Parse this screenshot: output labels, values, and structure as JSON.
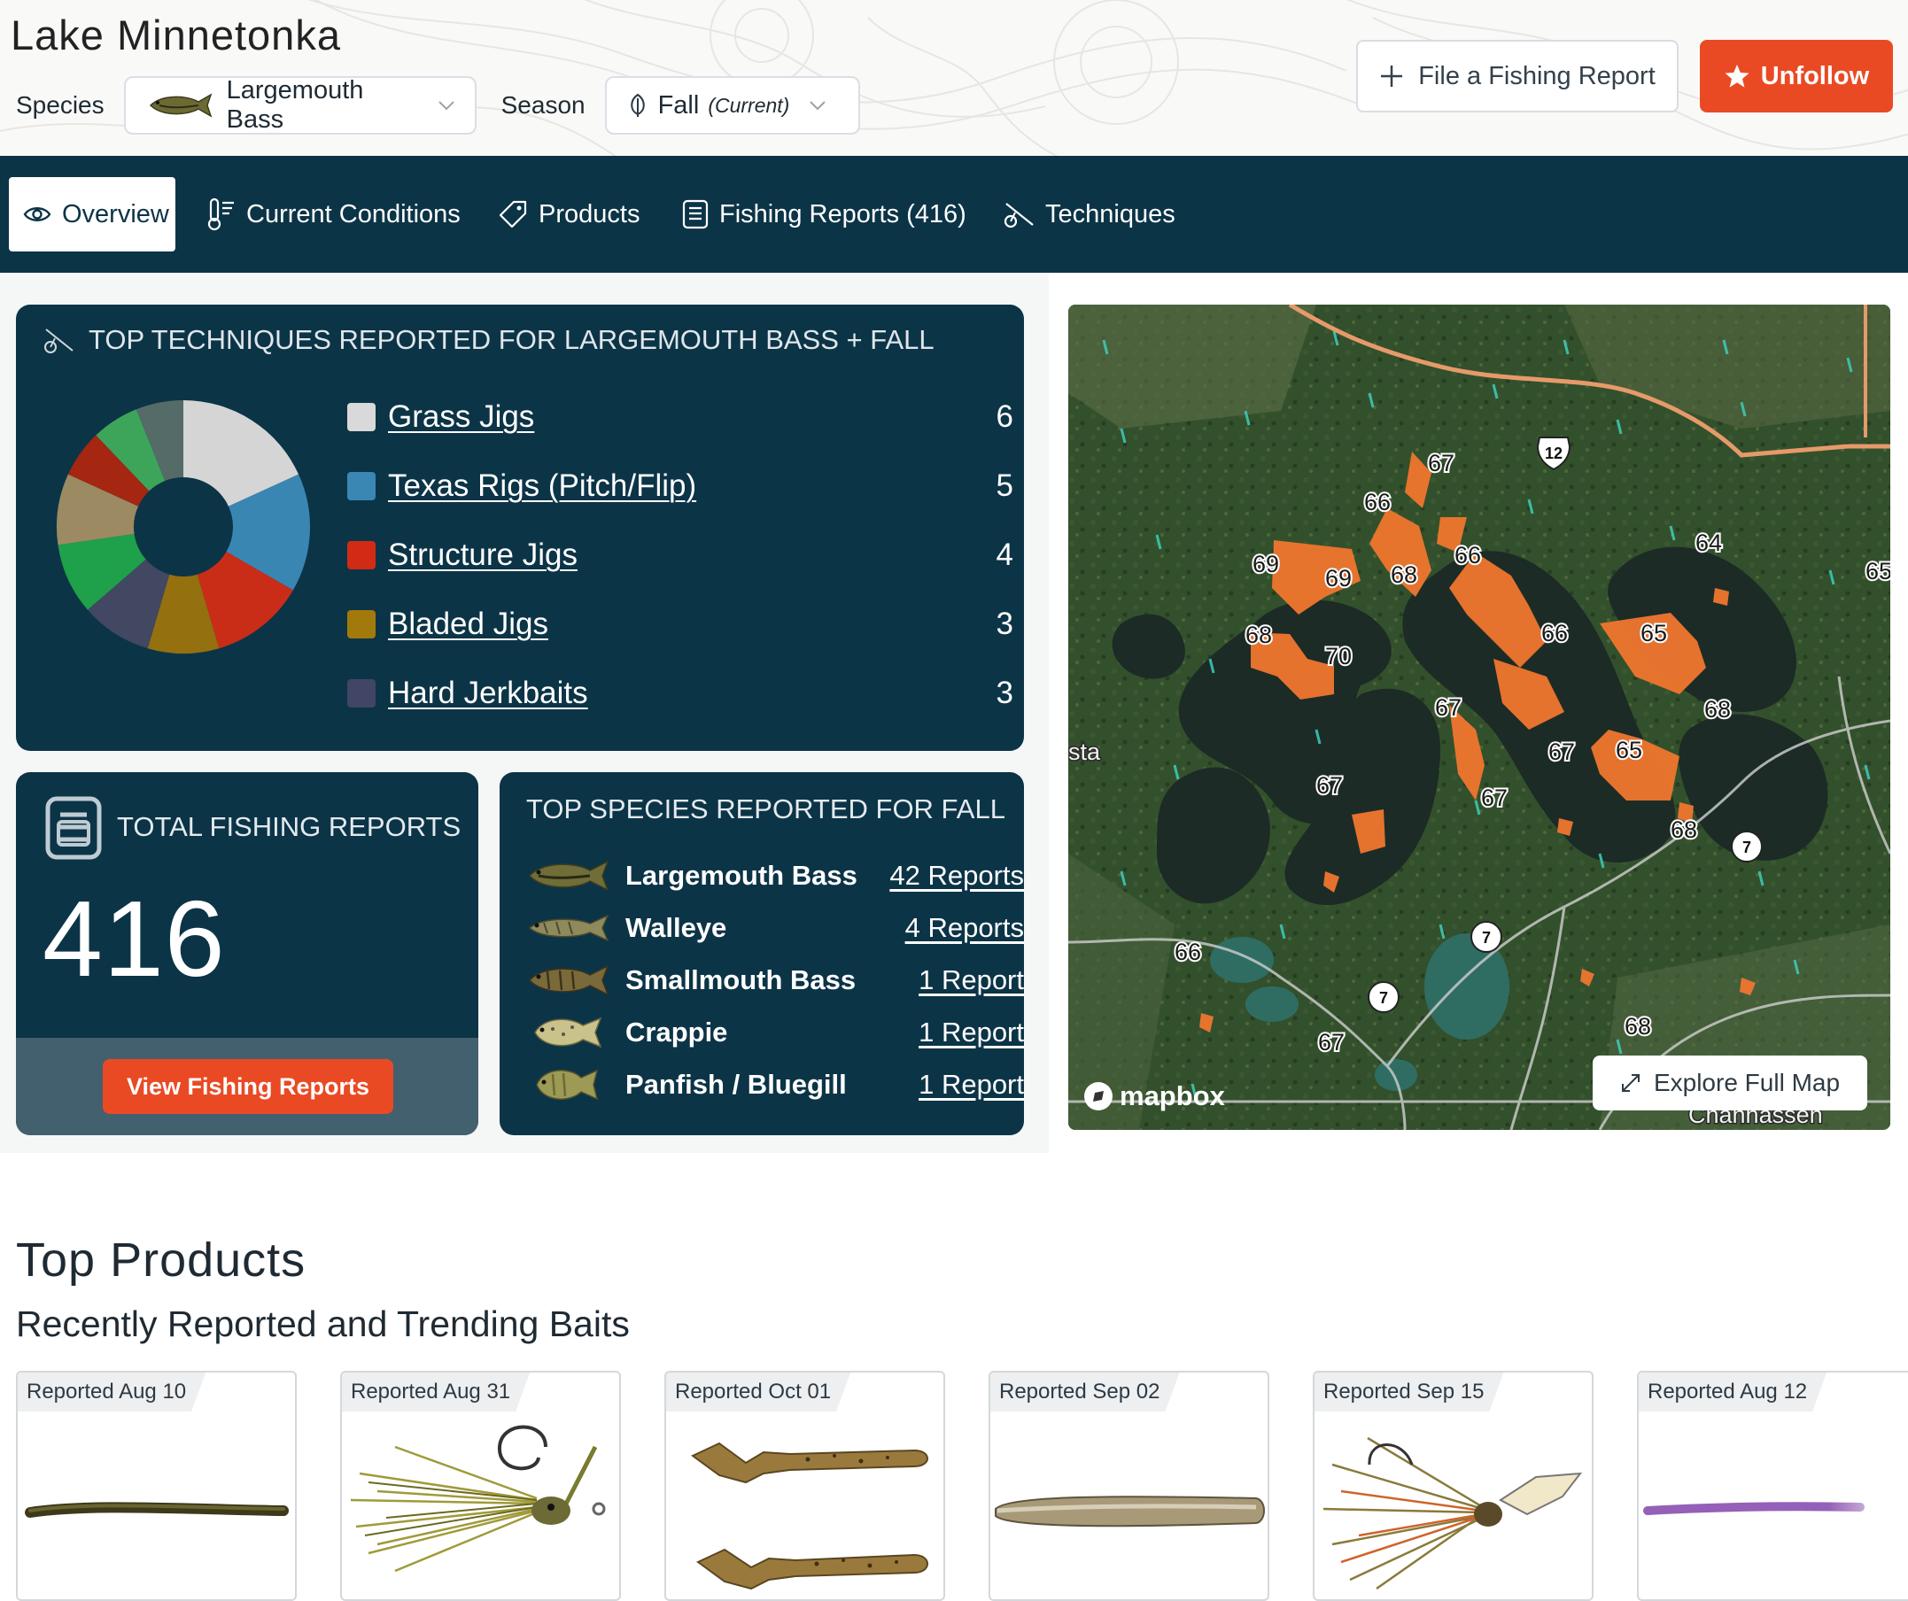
{
  "header": {
    "lake_name": "Lake Minnetonka",
    "species_label": "Species",
    "species_value": "Largemouth Bass",
    "season_label": "Season",
    "season_value": "Fall",
    "season_note": "(Current)",
    "file_report_label": "File a Fishing Report",
    "unfollow_label": "Unfollow"
  },
  "nav": {
    "tabs": [
      {
        "label": "Overview",
        "icon": "eye-icon",
        "active": true
      },
      {
        "label": "Current Conditions",
        "icon": "thermometer-icon"
      },
      {
        "label": "Products",
        "icon": "tag-icon"
      },
      {
        "label": "Fishing Reports (416)",
        "icon": "report-icon"
      },
      {
        "label": "Techniques",
        "icon": "fishing-rod-icon"
      }
    ]
  },
  "techniques": {
    "title": "TOP TECHNIQUES REPORTED FOR LARGEMOUTH BASS + FALL",
    "items": [
      {
        "name": "Grass Jigs",
        "count": "6",
        "color": "#d9d9d9"
      },
      {
        "name": "Texas Rigs (Pitch/Flip)",
        "count": "5",
        "color": "#3a87b4"
      },
      {
        "name": "Structure Jigs",
        "count": "4",
        "color": "#d12b16"
      },
      {
        "name": "Bladed Jigs",
        "count": "3",
        "color": "#a27a0b"
      },
      {
        "name": "Hard Jerkbaits",
        "count": "3",
        "color": "#414566"
      }
    ]
  },
  "chart_data": {
    "type": "pie",
    "slices": [
      {
        "label": "Grass Jigs",
        "value": 6,
        "color": "#d5d5d5"
      },
      {
        "label": "Texas Rigs (Pitch/Flip)",
        "value": 5,
        "color": "#3a86b2"
      },
      {
        "label": "Structure Jigs",
        "value": 4,
        "color": "#c92d18"
      },
      {
        "label": "Bladed Jigs",
        "value": 3,
        "color": "#94700f"
      },
      {
        "label": "Hard Jerkbaits",
        "value": 3,
        "color": "#424762"
      },
      {
        "value": 3,
        "color": "#1fa04a"
      },
      {
        "value": 3,
        "color": "#9c8a63"
      },
      {
        "value": 2,
        "color": "#a52611"
      },
      {
        "value": 2,
        "color": "#3da55a"
      },
      {
        "value": 2,
        "color": "#556b68"
      }
    ]
  },
  "total": {
    "title": "TOTAL FISHING REPORTS",
    "value": "416",
    "button": "View Fishing Reports"
  },
  "species": {
    "title": "TOP SPECIES REPORTED FOR FALL",
    "items": [
      {
        "name": "Largemouth Bass",
        "reports": "42 Reports"
      },
      {
        "name": "Walleye",
        "reports": "4 Reports"
      },
      {
        "name": "Smallmouth Bass",
        "reports": "1 Report"
      },
      {
        "name": "Crappie",
        "reports": "1 Report"
      },
      {
        "name": "Panfish / Bluegill",
        "reports": "1 Report"
      }
    ]
  },
  "map": {
    "explore_label": "Explore Full Map",
    "attribution": "mapbox",
    "place_labels": [
      "Chanhassen",
      "sta"
    ],
    "temperatures": [
      "67",
      "66",
      "69",
      "69",
      "68",
      "66",
      "68",
      "70",
      "66",
      "65",
      "64",
      "65",
      "68",
      "67",
      "67",
      "65",
      "67",
      "67",
      "68",
      "66",
      "67",
      "68"
    ],
    "route_shields": [
      "12",
      "7",
      "7",
      "7"
    ]
  },
  "products": {
    "heading": "Top Products",
    "subheading": "Recently Reported and Trending Baits",
    "cards": [
      {
        "reported": "Reported Aug 10"
      },
      {
        "reported": "Reported Aug 31"
      },
      {
        "reported": "Reported Oct 01"
      },
      {
        "reported": "Reported Sep 02"
      },
      {
        "reported": "Reported Sep 15"
      },
      {
        "reported": "Reported Aug 12"
      }
    ]
  }
}
